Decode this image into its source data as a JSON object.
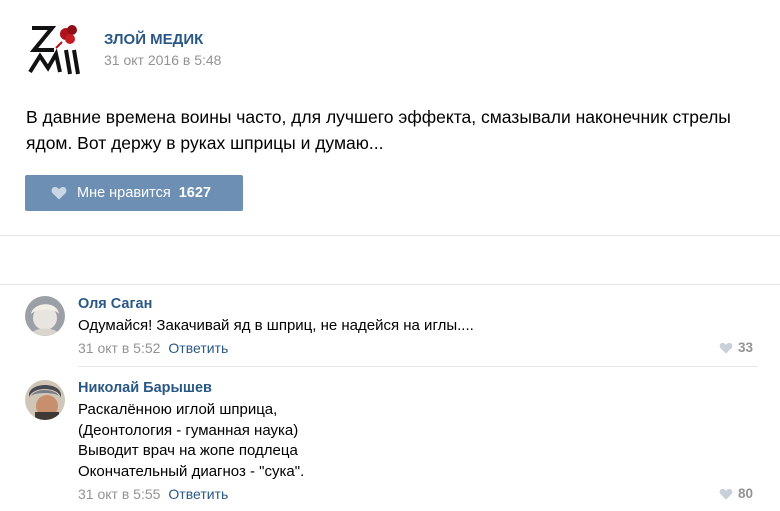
{
  "post": {
    "author": "ЗЛОЙ МЕДИК",
    "date": "31 окт 2016 в 5:48",
    "text": "В давние времена воины часто, для лучшего эффекта, смазывали наконечник стрелы ядом. Вот держу в руках шприцы и думаю...",
    "like_label": "Мне нравится",
    "like_count": "1627",
    "logo_text": "ЗЛМ"
  },
  "comments": [
    {
      "author": "Оля Саган",
      "lines": [
        "Одумайся! Закачивай яд в шприц, не надейся на иглы...."
      ],
      "date": "31 окт в 5:52",
      "reply_label": "Ответить",
      "likes": "33"
    },
    {
      "author": "Николай Барышев",
      "lines": [
        "Раскалённою иглой шприца,",
        "(Деонтология - гуманная наука)",
        "Выводит врач на жопе подлеца",
        "Окончательный диагноз - \"сука\"."
      ],
      "date": "31 окт в 5:55",
      "reply_label": "Ответить",
      "likes": "80"
    }
  ],
  "colors": {
    "link": "#2a5885",
    "muted": "#939393",
    "like_button": "#6d8fb3",
    "logo_red": "#b0121b"
  }
}
